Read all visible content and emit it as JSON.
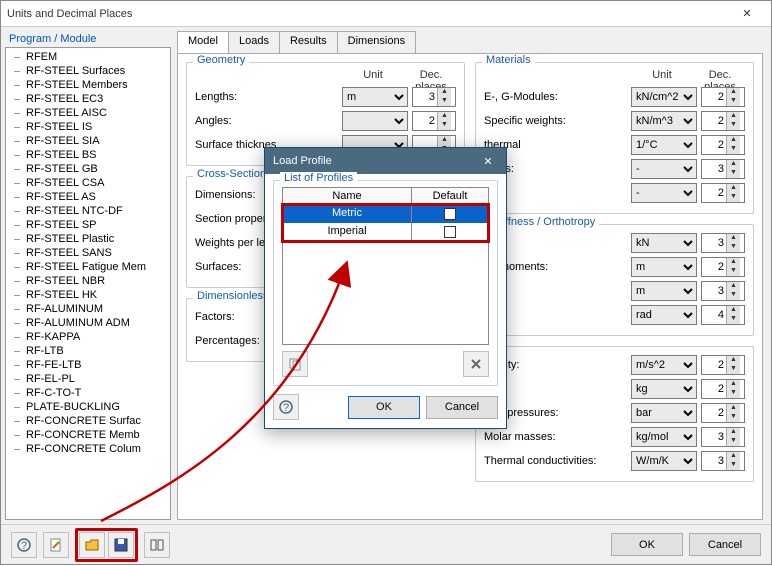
{
  "window": {
    "title": "Units and Decimal Places"
  },
  "left": {
    "label": "Program / Module",
    "items": [
      "RFEM",
      "RF-STEEL Surfaces",
      "RF-STEEL Members",
      "RF-STEEL EC3",
      "RF-STEEL AISC",
      "RF-STEEL IS",
      "RF-STEEL SIA",
      "RF-STEEL BS",
      "RF-STEEL GB",
      "RF-STEEL CSA",
      "RF-STEEL AS",
      "RF-STEEL NTC-DF",
      "RF-STEEL SP",
      "RF-STEEL Plastic",
      "RF-STEEL SANS",
      "RF-STEEL Fatigue Mem",
      "RF-STEEL NBR",
      "RF-STEEL HK",
      "RF-ALUMINUM",
      "RF-ALUMINUM ADM",
      "RF-KAPPA",
      "RF-LTB",
      "RF-FE-LTB",
      "RF-EL-PL",
      "RF-C-TO-T",
      "PLATE-BUCKLING",
      "RF-CONCRETE Surfac",
      "RF-CONCRETE Memb",
      "RF-CONCRETE Colum"
    ]
  },
  "tabs": [
    "Model",
    "Loads",
    "Results",
    "Dimensions"
  ],
  "headers": {
    "unit": "Unit",
    "dec": "Dec. places"
  },
  "groups": {
    "geometry": {
      "title": "Geometry",
      "rows": [
        {
          "label": "Lengths:",
          "unit": "m",
          "dec": "3"
        },
        {
          "label": "Angles:",
          "unit": "",
          "dec": "2"
        },
        {
          "label": "Surface thicknes",
          "unit": "",
          "dec": ""
        }
      ]
    },
    "cross": {
      "title": "Cross-Sections",
      "rows": [
        {
          "label": "Dimensions:",
          "unit": "",
          "dec": ""
        },
        {
          "label": "Section properties",
          "unit": "",
          "dec": ""
        },
        {
          "label": "Weights per leng",
          "unit": "",
          "dec": ""
        },
        {
          "label": "Surfaces:",
          "unit": "",
          "dec": ""
        }
      ]
    },
    "dimless": {
      "title": "Dimensionless",
      "rows": [
        {
          "label": "Factors:",
          "unit": "",
          "dec": ""
        },
        {
          "label": "Percentages:",
          "unit": "",
          "dec": ""
        }
      ]
    },
    "materials": {
      "title": "Materials",
      "rows": [
        {
          "label": "E-, G-Modules:",
          "unit": "kN/cm^2",
          "dec": "2"
        },
        {
          "label": "Specific weights:",
          "unit": "kN/m^3",
          "dec": "2"
        },
        {
          "label": "thermal",
          "unit": "1/°C",
          "dec": "2"
        },
        {
          "label": "ratios:",
          "unit": "-",
          "dec": "3"
        },
        {
          "label": "",
          "unit": "-",
          "dec": "2"
        }
      ]
    },
    "stiffness": {
      "title": "/ Stiffness / Orthotropy",
      "rows": [
        {
          "label": "",
          "unit": "kN",
          "dec": "3"
        },
        {
          "label": "for moments:",
          "unit": "m",
          "dec": "2"
        },
        {
          "label": "",
          "unit": "m",
          "dec": "3"
        },
        {
          "label": "",
          "unit": "rad",
          "dec": "4"
        }
      ]
    },
    "other": {
      "title": "",
      "rows": [
        {
          "label": "gravity:",
          "unit": "m/s^2",
          "dec": "2"
        },
        {
          "label": "",
          "unit": "kg",
          "dec": "2"
        },
        {
          "label": "Gas pressures:",
          "unit": "bar",
          "dec": "2"
        },
        {
          "label": "Molar masses:",
          "unit": "kg/mol",
          "dec": "3"
        },
        {
          "label": "Thermal conductivities:",
          "unit": "W/m/K",
          "dec": "3"
        }
      ]
    }
  },
  "footer": {
    "ok": "OK",
    "cancel": "Cancel"
  },
  "modal": {
    "title": "Load Profile",
    "group": "List of Profiles",
    "col_name": "Name",
    "col_default": "Default",
    "rows": [
      {
        "name": "Metric",
        "default": true,
        "selected": true
      },
      {
        "name": "Imperial",
        "default": false,
        "selected": false
      }
    ],
    "ok": "OK",
    "cancel": "Cancel"
  }
}
